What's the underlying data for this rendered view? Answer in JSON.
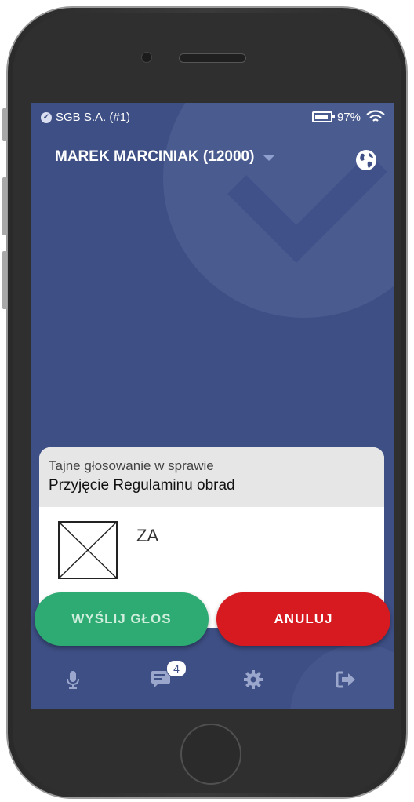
{
  "status_bar": {
    "org": "SGB S.A. (#1)",
    "battery": "97%"
  },
  "header": {
    "user": "MAREK MARCINIAK (12000)"
  },
  "dialog": {
    "subtitle": "Tajne głosowanie w sprawie",
    "title": "Przyjęcie Regulaminu obrad",
    "option_label": "ZA"
  },
  "buttons": {
    "send": "WYŚLIJ GŁOS",
    "cancel": "ANULUJ"
  },
  "nav": {
    "chat_badge": "4"
  },
  "colors": {
    "screen_bg": "#3e4f85",
    "send": "#2eab73",
    "cancel": "#d61a1f"
  },
  "icons": [
    "check-circle-icon",
    "battery-icon",
    "wifi-icon",
    "caret-down-icon",
    "globe-icon",
    "microphone-icon",
    "chat-icon",
    "gear-icon",
    "sign-out-icon"
  ]
}
